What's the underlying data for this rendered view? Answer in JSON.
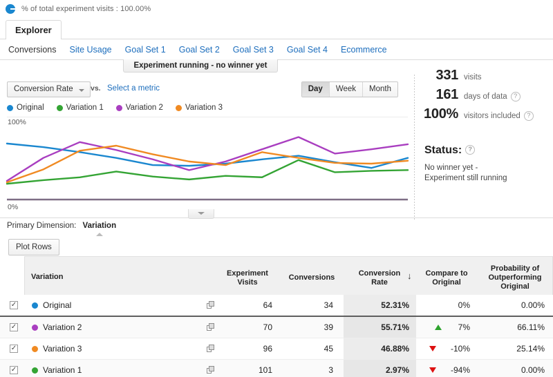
{
  "top_bar": {
    "icon": "pie-chart-icon",
    "text": "% of total experiment visits : 100.00%"
  },
  "tab": {
    "label": "Explorer"
  },
  "subnav": {
    "items": [
      {
        "label": "Conversions",
        "current": true
      },
      {
        "label": "Site Usage",
        "current": false
      },
      {
        "label": "Goal Set 1",
        "current": false
      },
      {
        "label": "Goal Set 2",
        "current": false
      },
      {
        "label": "Goal Set 3",
        "current": false
      },
      {
        "label": "Goal Set 4",
        "current": false
      },
      {
        "label": "Ecommerce",
        "current": false
      }
    ]
  },
  "banner": {
    "text": "Experiment running - no winner yet"
  },
  "chart_controls": {
    "metric_button": "Conversion Rate",
    "vs_label": "vs.",
    "select_metric_link": "Select a metric",
    "granularity": [
      {
        "label": "Day",
        "active": true
      },
      {
        "label": "Week",
        "active": false
      },
      {
        "label": "Month",
        "active": false
      }
    ]
  },
  "stats": {
    "visits_value": "331",
    "visits_label": "visits",
    "days_value": "161",
    "days_label": "days of data",
    "visitors_value": "100%",
    "visitors_label": "visitors included",
    "help_glyph": "?",
    "status_heading": "Status:",
    "status_line1": "No winner yet -",
    "status_line2": "Experiment still running"
  },
  "primary_dimension": {
    "label": "Primary Dimension:",
    "value": "Variation"
  },
  "plot_rows_button": "Plot Rows",
  "table": {
    "columns": {
      "variation": "Variation",
      "experiment_visits_l1": "Experiment",
      "experiment_visits_l2": "Visits",
      "conversions": "Conversions",
      "conversion_rate_l1": "Conversion",
      "conversion_rate_l2": "Rate",
      "sort_arrow": "↓",
      "compare_l1": "Compare to",
      "compare_l2": "Original",
      "probability_l1": "Probability of",
      "probability_l2": "Outperforming",
      "probability_l3": "Original"
    },
    "rows": [
      {
        "checkbox": "✓",
        "name": "Original",
        "color": "#1a87cf",
        "experiment_visits": "64",
        "conversions": "34",
        "conversion_rate": "52.31%",
        "compare": "0%",
        "compare_dir": "none",
        "probability": "0.00%"
      },
      {
        "checkbox": "✓",
        "name": "Variation 2",
        "color": "#a93ec0",
        "experiment_visits": "70",
        "conversions": "39",
        "conversion_rate": "55.71%",
        "compare": "7%",
        "compare_dir": "up",
        "probability": "66.11%"
      },
      {
        "checkbox": "✓",
        "name": "Variation 3",
        "color": "#f08a22",
        "experiment_visits": "96",
        "conversions": "45",
        "conversion_rate": "46.88%",
        "compare": "-10%",
        "compare_dir": "down",
        "probability": "25.14%"
      },
      {
        "checkbox": "✓",
        "name": "Variation 1",
        "color": "#34a434",
        "experiment_visits": "101",
        "conversions": "3",
        "conversion_rate": "2.97%",
        "compare": "-94%",
        "compare_dir": "down",
        "probability": "0.00%"
      }
    ]
  },
  "chart_data": {
    "type": "line",
    "title": "",
    "xlabel": "",
    "ylabel": "",
    "ylim": [
      0,
      100
    ],
    "ytick_labels": [
      "0%",
      "100%"
    ],
    "grid": false,
    "legend_position": "top-left",
    "x": [
      1,
      2,
      3,
      4,
      5,
      6,
      7,
      8,
      9,
      10,
      11,
      12
    ],
    "series": [
      {
        "name": "Original",
        "color": "#1a87cf",
        "values": [
          78,
          73,
          66,
          58,
          48,
          47,
          50,
          56,
          61,
          52,
          44,
          58
        ]
      },
      {
        "name": "Variation 1",
        "color": "#34a434",
        "values": [
          22,
          27,
          31,
          39,
          32,
          28,
          33,
          31,
          55,
          38,
          40,
          41
        ]
      },
      {
        "name": "Variation 2",
        "color": "#a93ec0",
        "values": [
          26,
          58,
          80,
          69,
          56,
          41,
          53,
          70,
          87,
          64,
          70,
          77
        ]
      },
      {
        "name": "Variation 3",
        "color": "#f08a22",
        "values": [
          24,
          42,
          68,
          75,
          63,
          53,
          48,
          66,
          58,
          51,
          50,
          54
        ]
      }
    ]
  }
}
